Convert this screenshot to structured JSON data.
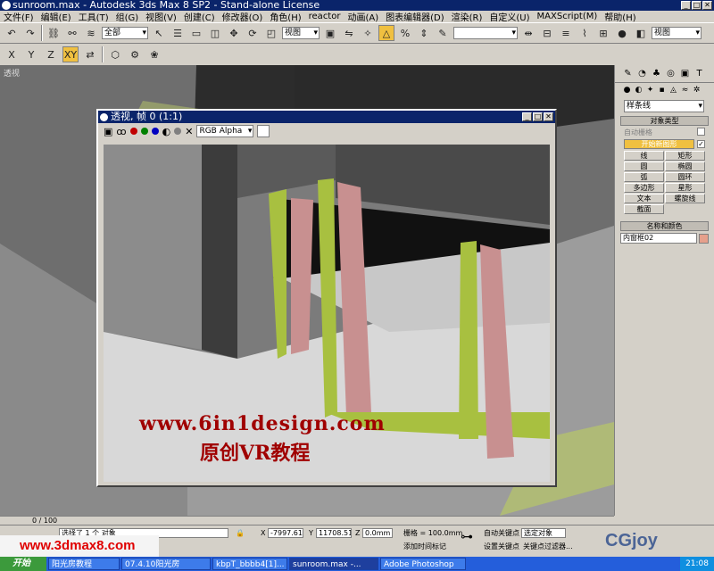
{
  "window": {
    "title": "sunroom.max - Autodesk 3ds Max 8 SP2 - Stand-alone License",
    "min": "_",
    "max": "□",
    "close": "✕"
  },
  "menu": [
    "文件(F)",
    "编辑(E)",
    "工具(T)",
    "组(G)",
    "视图(V)",
    "创建(C)",
    "修改器(O)",
    "角色(H)",
    "reactor",
    "动画(A)",
    "图表编辑器(D)",
    "渲染(R)",
    "自定义(U)",
    "MAXScript(M)",
    "帮助(H)"
  ],
  "toolbar": {
    "selection_filter": "全部",
    "ref_coord": "视图",
    "named_sel": "",
    "view_combo": "视图",
    "xy_label": "XY"
  },
  "axis_buttons": [
    "X",
    "Y",
    "Z",
    "XY"
  ],
  "viewport": {
    "label": "透视"
  },
  "command_panel": {
    "category_combo": "样条线",
    "object_type_header": "对象类型",
    "autogrid_label": "自动栅格",
    "start_new_shape": "开始新图形",
    "start_new_checked": "✓",
    "object_buttons": [
      "线",
      "矩形",
      "圆",
      "椭圆",
      "弧",
      "圆环",
      "多边形",
      "星形",
      "文本",
      "螺旋线",
      "截面"
    ],
    "name_color_header": "名称和颜色",
    "object_name": "内窗框02",
    "swatch_color": "#e6a08c"
  },
  "vfb": {
    "title": "透视, 帧 0 (1:1)",
    "channel": "RGB Alpha",
    "wm_url": "www.6in1design.com",
    "wm_text": "原创VR教程"
  },
  "timeslider": {
    "frame": "0 / 100"
  },
  "status": {
    "selected": "选择了 1 个 对象",
    "x_label": "X",
    "x_val": "-7997.613",
    "y_label": "Y",
    "y_val": "11708.511",
    "z_label": "Z",
    "z_val": "0.0mm",
    "grid": "栅格 = 100.0mm",
    "add_time_tag": "添加时间标记",
    "auto_key": "自动关键点",
    "set_key": "设置关键点",
    "selected_obj": "选定对象",
    "key_filter": "关键点过滤器..."
  },
  "watermarks": {
    "left": "www.3dmax8.com",
    "right": "CGjoy"
  },
  "taskbar": {
    "start": "开始",
    "tasks": [
      "阳光房教程",
      "07.4.10阳光房",
      "kbpT_bbbb4[1]...",
      "sunroom.max -...",
      "Adobe Photoshop"
    ],
    "clock": "21:08"
  }
}
